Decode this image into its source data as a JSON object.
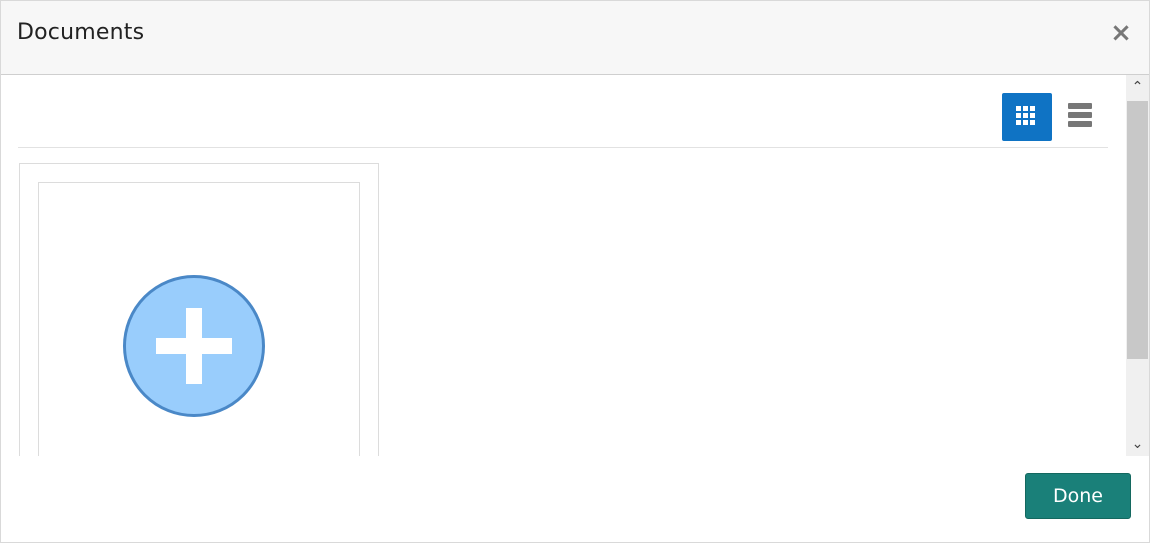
{
  "dialog": {
    "title": "Documents",
    "close_icon": "×"
  },
  "toolbar": {
    "grid_view_icon": "grid-view-icon",
    "list_view_icon": "list-view-icon",
    "active_view": "grid"
  },
  "documents": {
    "add_icon": "plus-circle-icon",
    "colors": {
      "circle_fill": "#99cdfc",
      "circle_border": "#4a88c7"
    }
  },
  "scrollbar": {
    "up_arrow": "⌃",
    "down_arrow": "⌄"
  },
  "footer": {
    "done_label": "Done"
  },
  "colors": {
    "accent": "#0f73c4",
    "done_button": "#1a8079"
  }
}
